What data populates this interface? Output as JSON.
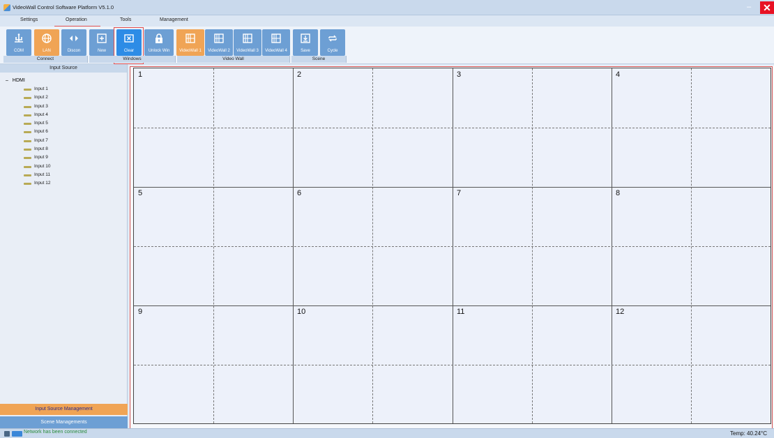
{
  "window": {
    "title": "VideoWall Control Software Platform V5.1.0",
    "minimize": "–",
    "close": "✕"
  },
  "menu": {
    "tabs": [
      {
        "label": "Settings"
      },
      {
        "label": "Operation"
      },
      {
        "label": "Tools"
      },
      {
        "label": "Management"
      }
    ],
    "active_tab": "Operation"
  },
  "ribbon": {
    "buttons": [
      {
        "label": "COM",
        "icon": "com-port-icon"
      },
      {
        "label": "LAN",
        "icon": "globe-icon",
        "active": true
      },
      {
        "label": "Discon",
        "icon": "disconnect-icon"
      },
      {
        "label": "New",
        "icon": "new-window-icon"
      },
      {
        "label": "Clear",
        "icon": "clear-icon",
        "selected": true
      },
      {
        "label": "Unlock Win",
        "icon": "lock-icon"
      },
      {
        "label": "VideoWall 1",
        "icon": "videowall-icon",
        "active": true
      },
      {
        "label": "VideoWall 2",
        "icon": "videowall-icon"
      },
      {
        "label": "VideoWall 3",
        "icon": "videowall-icon"
      },
      {
        "label": "VideoWall 4",
        "icon": "videowall-icon"
      },
      {
        "label": "Save",
        "icon": "save-icon"
      },
      {
        "label": "Cycle",
        "icon": "cycle-icon"
      }
    ],
    "groups": [
      {
        "label": "Connect"
      },
      {
        "label": "Windows"
      },
      {
        "label": "Video Wall"
      },
      {
        "label": "Scene"
      }
    ]
  },
  "left_panel": {
    "header": "Input Source",
    "tree_toggle": "–",
    "tree_root": "HDMI",
    "inputs": [
      "Input 1",
      "Input 2",
      "Input 3",
      "Input 4",
      "Input 5",
      "Input 6",
      "Input 7",
      "Input 8",
      "Input 9",
      "Input 10",
      "Input 11",
      "Input 12"
    ],
    "input_source_management": "Input Source Management",
    "scene_managements": "Scene Managements"
  },
  "wall": {
    "screens": [
      "1",
      "2",
      "3",
      "4",
      "5",
      "6",
      "7",
      "8",
      "9",
      "10",
      "11",
      "12"
    ],
    "columns": 4,
    "rows": 3
  },
  "status": {
    "message": "Network has been connected",
    "temperature": "Temp: 40.24°C"
  },
  "colors": {
    "active_orange": "#f0a455",
    "button_blue": "#6d9fd4",
    "selected_blue": "#2d8ce6",
    "close_red": "#e81123",
    "highlight_red": "#d05050",
    "status_green": "#2a8a3a"
  }
}
